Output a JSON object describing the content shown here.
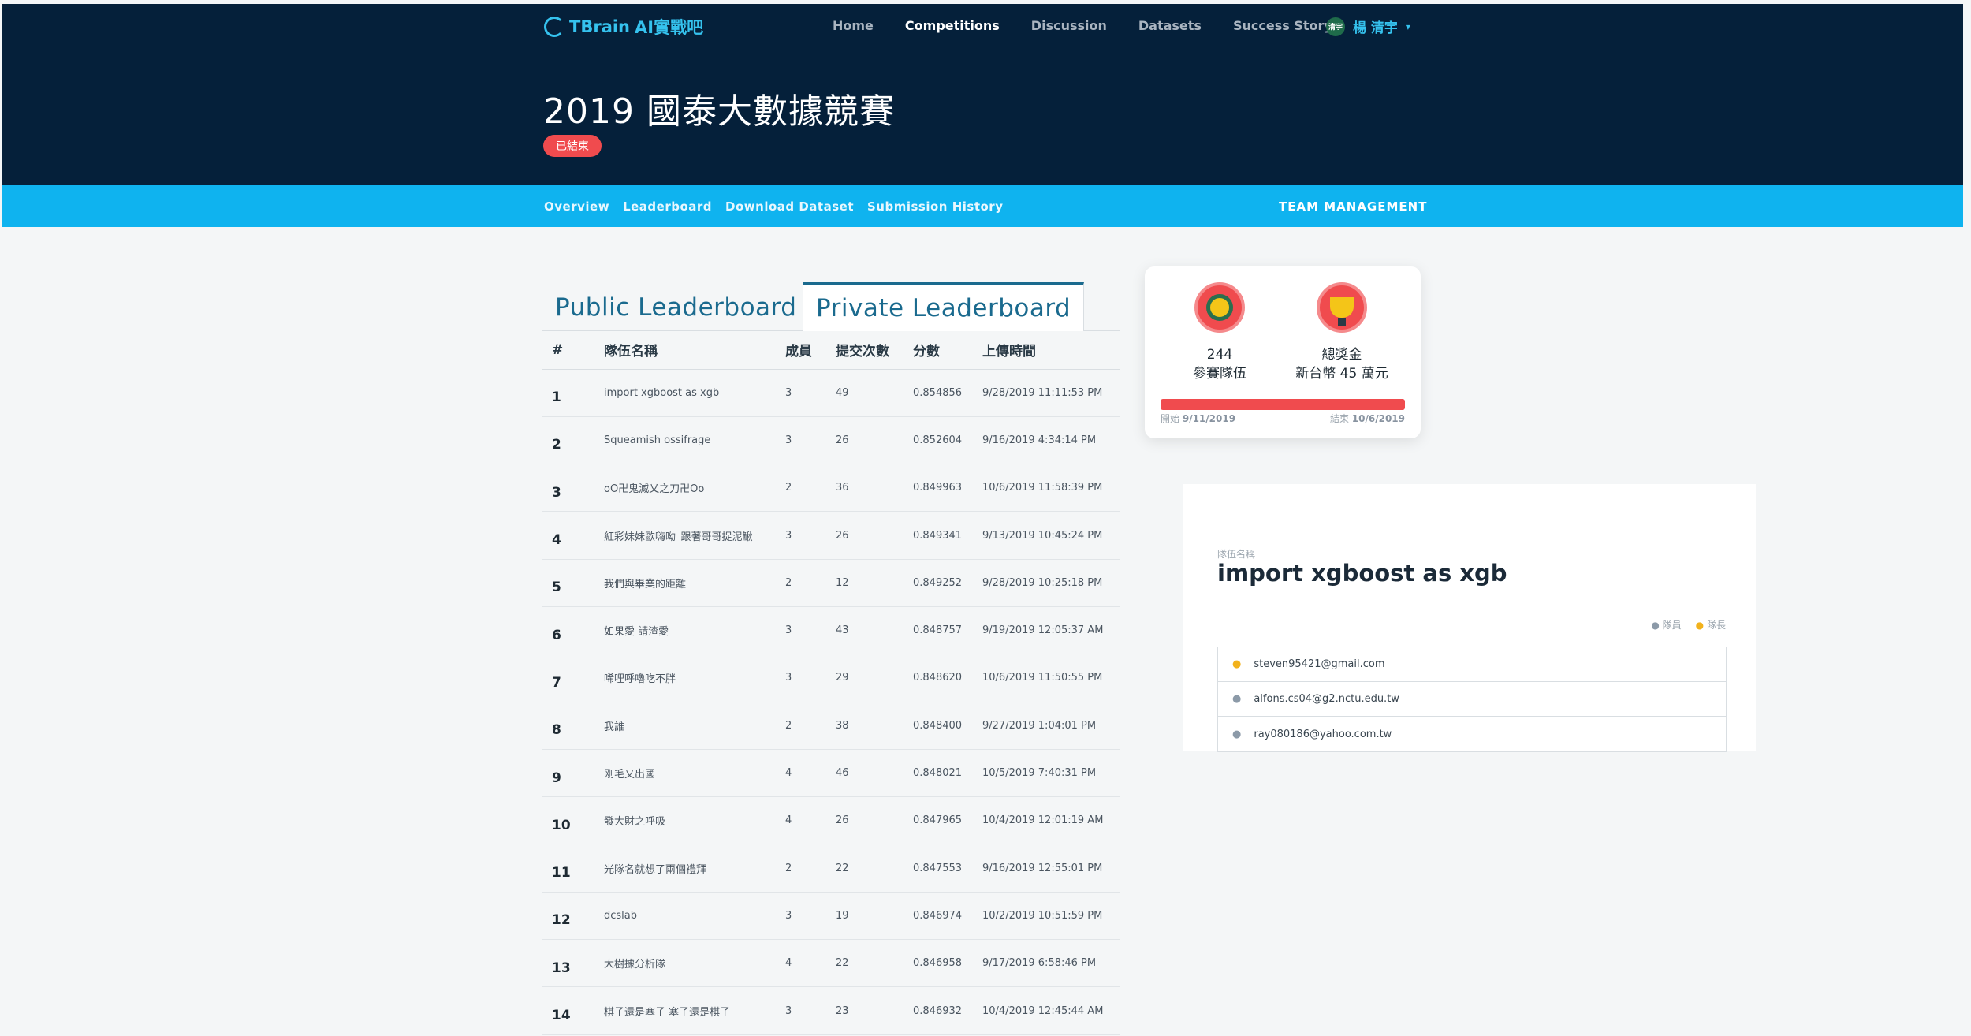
{
  "header": {
    "logo_text": "TBrain",
    "logo_ai": "AI實戰吧",
    "nav": [
      "Home",
      "Competitions",
      "Discussion",
      "Datasets",
      "Success Story"
    ],
    "active_nav": "Competitions",
    "user_avatar": "清宇",
    "user_name": "楊 清宇",
    "title": "2019 國泰大數據競賽",
    "status": "已結束"
  },
  "subnav": {
    "overview": "Overview",
    "leaderboard": "Leaderboard",
    "download": "Download Dataset",
    "history": "Submission History",
    "team_management": "TEAM MANAGEMENT"
  },
  "tabs": {
    "public": "Public Leaderboard",
    "private": "Private Leaderboard"
  },
  "table": {
    "headers": [
      "#",
      "隊伍名稱",
      "成員",
      "提交次數",
      "分數",
      "上傳時間"
    ],
    "rows": [
      [
        "1",
        "import xgboost as xgb",
        "3",
        "49",
        "0.854856",
        "9/28/2019 11:11:53 PM"
      ],
      [
        "2",
        "Squeamish ossifrage",
        "3",
        "26",
        "0.852604",
        "9/16/2019 4:34:14 PM"
      ],
      [
        "3",
        "oO卍鬼滅乂之刀卍Oo",
        "2",
        "36",
        "0.849963",
        "10/6/2019 11:58:39 PM"
      ],
      [
        "4",
        "紅彩妹妹歐嗨呦_跟著哥哥捉泥鰍",
        "3",
        "26",
        "0.849341",
        "9/13/2019 10:45:24 PM"
      ],
      [
        "5",
        "我們與畢業的距離",
        "2",
        "12",
        "0.849252",
        "9/28/2019 10:25:18 PM"
      ],
      [
        "6",
        "如果愛 請渣愛",
        "3",
        "43",
        "0.848757",
        "9/19/2019 12:05:37 AM"
      ],
      [
        "7",
        "唏哩呼嚕吃不胖",
        "3",
        "29",
        "0.848620",
        "10/6/2019 11:50:55 PM"
      ],
      [
        "8",
        "我誰",
        "2",
        "38",
        "0.848400",
        "9/27/2019 1:04:01 PM"
      ],
      [
        "9",
        "刚毛又出國",
        "4",
        "46",
        "0.848021",
        "10/5/2019 7:40:31 PM"
      ],
      [
        "10",
        "發大財之呼吸",
        "4",
        "26",
        "0.847965",
        "10/4/2019 12:01:19 AM"
      ],
      [
        "11",
        "光隊名就想了兩個禮拜",
        "2",
        "22",
        "0.847553",
        "9/16/2019 12:55:01 PM"
      ],
      [
        "12",
        "dcslab",
        "3",
        "19",
        "0.846974",
        "10/2/2019 10:51:59 PM"
      ],
      [
        "13",
        "大樹據分析隊",
        "4",
        "22",
        "0.846958",
        "9/17/2019 6:58:46 PM"
      ],
      [
        "14",
        "棋子還是塞子 塞子還是棋子",
        "3",
        "23",
        "0.846932",
        "10/4/2019 12:45:44 AM"
      ]
    ]
  },
  "stats": {
    "teams_count": "244",
    "teams_label": "參賽隊伍",
    "prize_label": "總獎金",
    "prize_value": "新台幣 45 萬元",
    "start_label": "開始",
    "start_date": "9/11/2019",
    "end_label": "結束",
    "end_date": "10/6/2019",
    "progress_fraction": 1.0,
    "accent_color": "#f04b4e"
  },
  "team_panel": {
    "caption": "隊伍名稱",
    "name": "import xgboost as xgb",
    "legend_member": "隊員",
    "legend_leader": "隊長",
    "members": [
      {
        "email": "steven95421@gmail.com",
        "role": "leader"
      },
      {
        "email": "alfons.cs04@g2.nctu.edu.tw",
        "role": "member"
      },
      {
        "email": "ray080186@yahoo.com.tw",
        "role": "member"
      }
    ]
  }
}
